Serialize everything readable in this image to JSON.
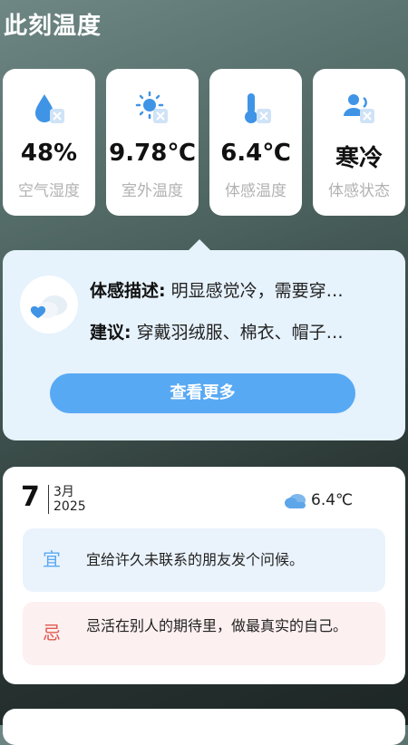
{
  "header": {
    "title": "此刻温度"
  },
  "metrics": [
    {
      "value": "48%",
      "label": "空气湿度",
      "icon": "humidity-icon"
    },
    {
      "value": "9.78℃",
      "label": "室外温度",
      "icon": "sun-thermometer-icon"
    },
    {
      "value": "6.4℃",
      "label": "体感温度",
      "icon": "thermometer-icon"
    },
    {
      "value": "寒冷",
      "label": "体感状态",
      "icon": "person-status-icon"
    }
  ],
  "feel": {
    "desc_label": "体感描述:",
    "desc_text": "明显感觉冷，需要穿…",
    "advice_label": "建议:",
    "advice_text": "穿戴羽绒服、棉衣、帽子…",
    "more_button": "查看更多"
  },
  "calendar": {
    "day": "7",
    "month": "3月",
    "year": "2025",
    "weather_temp": "6.4℃",
    "yi_label": "宜",
    "yi_text": "宜给许久未联系的朋友发个问候。",
    "ji_label": "忌",
    "ji_text": "忌活在别人的期待里，做最真实的自己。"
  },
  "colors": {
    "accent": "#58a9f4",
    "panel": "#e6f2fc",
    "yi": "#58a9f4",
    "ji": "#e05a50"
  }
}
